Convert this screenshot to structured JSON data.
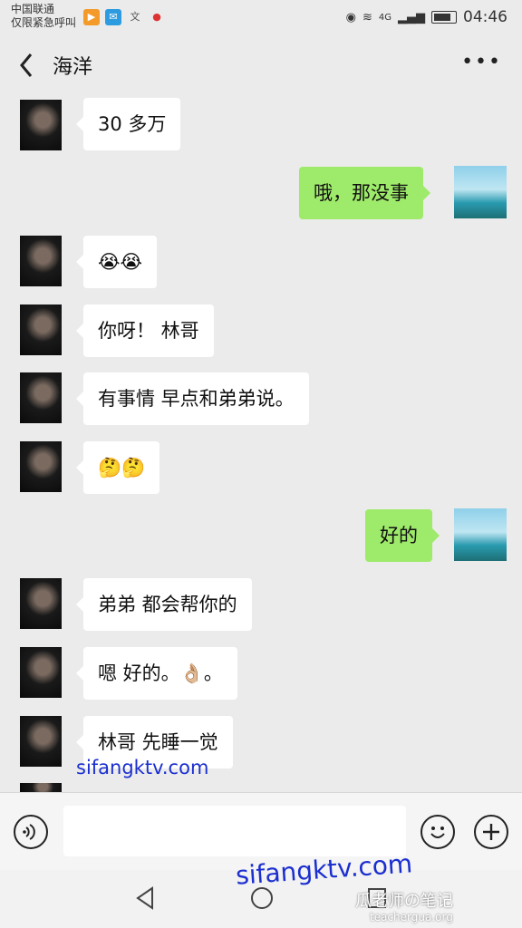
{
  "status_bar": {
    "carrier_line1": "中国联通",
    "carrier_line2": "仅限紧急呼叫",
    "signal": "4G",
    "time": "04:46"
  },
  "header": {
    "title": "海洋",
    "more_label": "•••"
  },
  "messages": [
    {
      "side": "left",
      "text": "30 多万"
    },
    {
      "side": "right",
      "text": "哦，那没事"
    },
    {
      "side": "left",
      "text": "😭😭"
    },
    {
      "side": "left",
      "text": "你呀！ 林哥"
    },
    {
      "side": "left",
      "text": "有事情 早点和弟弟说。"
    },
    {
      "side": "left",
      "text": "🤔🤔"
    },
    {
      "side": "right",
      "text": "好的"
    },
    {
      "side": "left",
      "text": "弟弟 都会帮你的"
    },
    {
      "side": "left",
      "text": "嗯 好的。👌🏼。"
    },
    {
      "side": "left",
      "text": "林哥 先睡一觉"
    }
  ],
  "watermark": {
    "small": "sifangktv.com",
    "large": "sifangktv.com",
    "brand": "瓜老师の笔记",
    "brand_url": "teachergua.org"
  },
  "icons": {
    "voice": "voice-icon",
    "emoji": "emoji-icon",
    "plus": "plus-icon"
  }
}
